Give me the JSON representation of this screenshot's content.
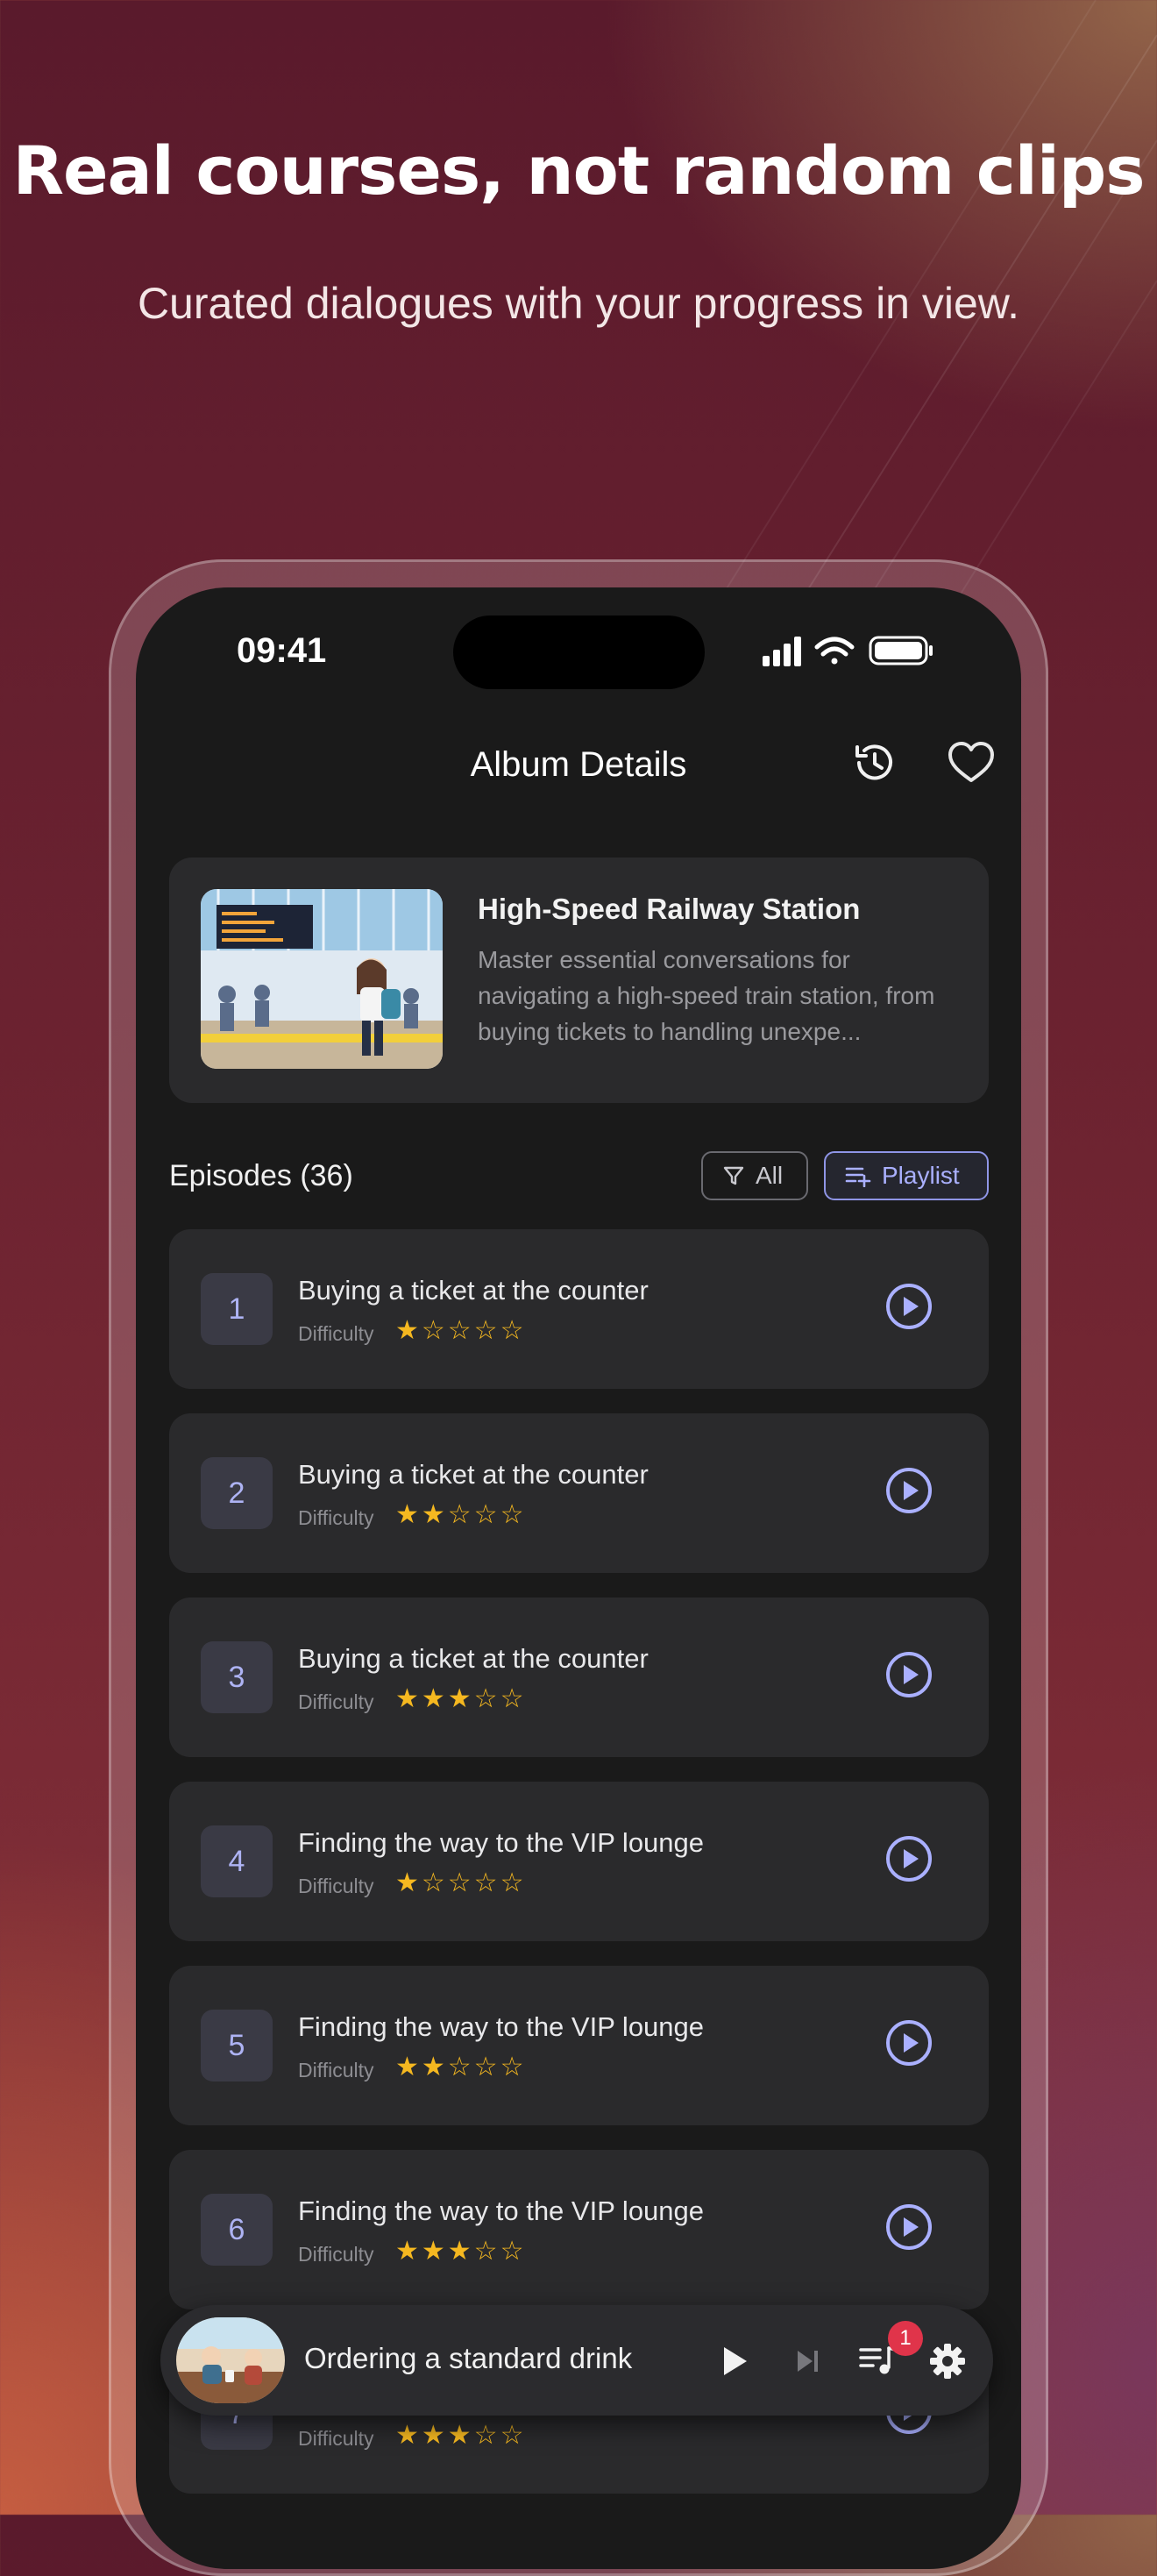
{
  "promo": {
    "headline": "Real courses, not random clips",
    "subline": "Curated dialogues with your progress in view."
  },
  "status_bar": {
    "time": "09:41"
  },
  "nav": {
    "title": "Album Details",
    "history_icon": "history-icon",
    "favorite_icon": "heart-icon"
  },
  "album": {
    "title": "High-Speed Railway Station",
    "description": "Master essential conversations for navigating a high-speed train station, from buying tickets to handling unexpe..."
  },
  "episodes_section": {
    "title": "Episodes (36)",
    "filter_label": "All",
    "playlist_label": "Playlist"
  },
  "difficulty_label": "Difficulty",
  "episodes": [
    {
      "number": "1",
      "title": "Buying a ticket at the counter",
      "stars": "★☆☆☆☆",
      "rating": 1
    },
    {
      "number": "2",
      "title": "Buying a ticket at the counter",
      "stars": "★★☆☆☆",
      "rating": 2
    },
    {
      "number": "3",
      "title": "Buying a ticket at the counter",
      "stars": "★★★☆☆",
      "rating": 3
    },
    {
      "number": "4",
      "title": "Finding the way to the VIP lounge",
      "stars": "★☆☆☆☆",
      "rating": 1
    },
    {
      "number": "5",
      "title": "Finding the way to the VIP lounge",
      "stars": "★★☆☆☆",
      "rating": 2
    },
    {
      "number": "6",
      "title": "Finding the way to the VIP lounge",
      "stars": "★★★☆☆",
      "rating": 3
    },
    {
      "number": "7",
      "title": "",
      "stars": "★★★☆☆",
      "rating": 3
    }
  ],
  "mini_player": {
    "title": "Ordering a standard drink",
    "queue_badge": "1"
  },
  "colors": {
    "accent": "#aab0ff",
    "star": "#f5b820",
    "card": "#2a2a2c",
    "screen": "#1a1a1a",
    "badge": "#e0344a"
  }
}
